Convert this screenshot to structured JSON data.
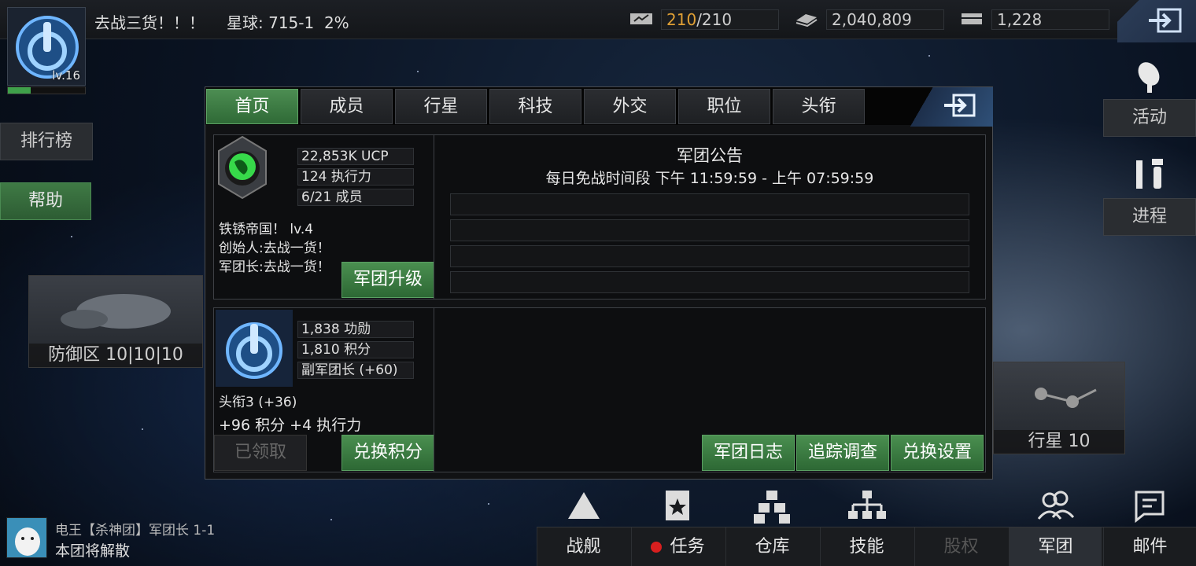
{
  "player": {
    "name": "去战三货！！！",
    "level": "lv.16"
  },
  "planet": {
    "label": "星球: 715-1",
    "percent": "2%"
  },
  "resources": {
    "energy_current": "210",
    "energy_max": "/210",
    "credits": "2,040,809",
    "crystal": "1,228"
  },
  "left_menu": {
    "ranking": "排行榜",
    "help": "帮助"
  },
  "right_menu": {
    "events": "活动",
    "progress": "进程"
  },
  "map": {
    "defense_zone": "防御区 10|10|10",
    "planet_tile": "行星 10"
  },
  "panel": {
    "tabs": [
      "首页",
      "成员",
      "行星",
      "科技",
      "外交",
      "职位",
      "头衔"
    ],
    "active_tab": "首页",
    "legion": {
      "ucp": "22,853K UCP",
      "action_power": "124 执行力",
      "members": "6/21 成员",
      "name_level": "铁锈帝国！ lv.4",
      "founder": "创始人:去战一货！",
      "leader": "军团长:去战一货！",
      "upgrade_button": "军团升级"
    },
    "notice": {
      "title": "军团公告",
      "truce": "每日免战时间段 下午 11:59:59 - 上午 07:59:59"
    },
    "personal": {
      "merit": "1,838 功勋",
      "points": "1,810 积分",
      "position": "副军团长 (+60)",
      "title": "头衔3 (+36)",
      "bonus": "+96 积分  +4 执行力",
      "claimed_button": "已领取",
      "exchange_button": "兑换积分"
    },
    "actions": {
      "log": "军团日志",
      "track": "追踪调查",
      "exchange_settings": "兑换设置"
    }
  },
  "chat": {
    "sender": "电王【杀神团】军团长 1-1",
    "message": "本团将解散"
  },
  "nav": {
    "ship": "战舰",
    "mission": "任务",
    "warehouse": "仓库",
    "skill": "技能",
    "equity": "股权",
    "legion": "军团",
    "mail": "邮件"
  },
  "colors": {
    "accent_green": "#3f8a47",
    "energy_orange": "#e0a035",
    "panel_bg": "#111214"
  }
}
